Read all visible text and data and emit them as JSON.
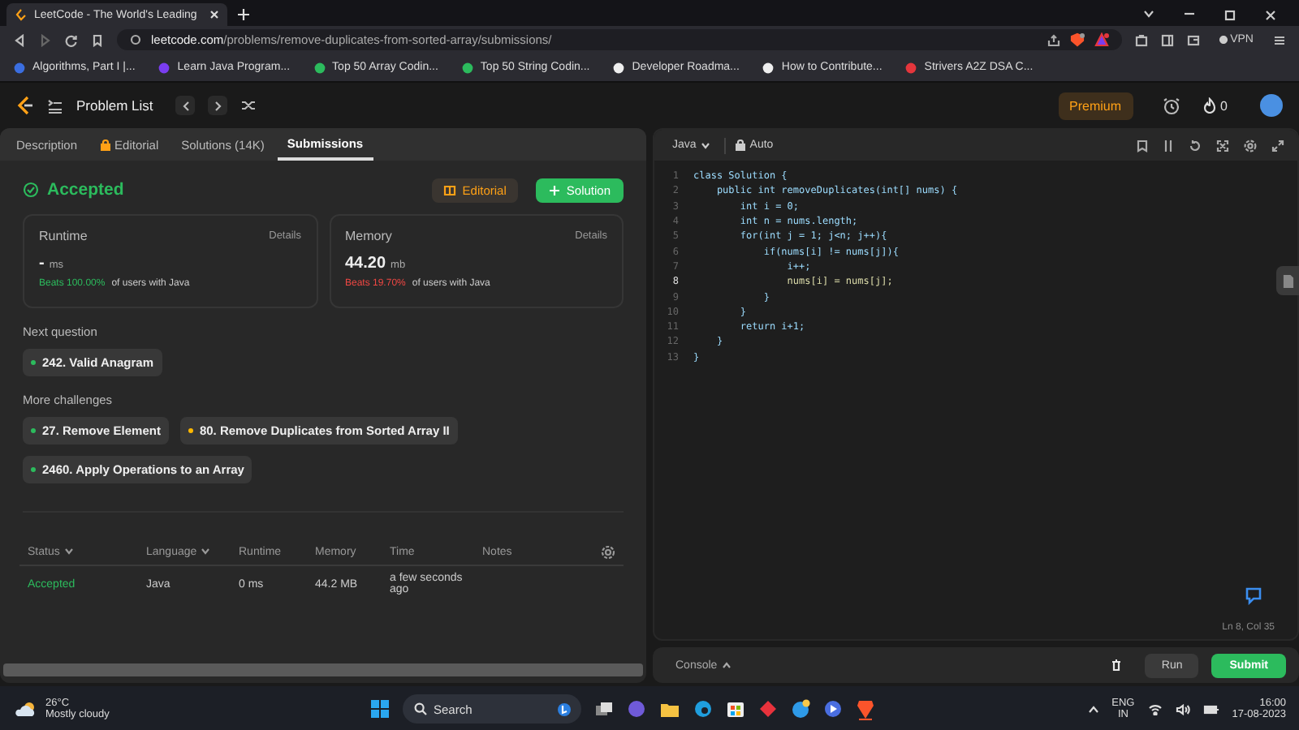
{
  "browser": {
    "tab": {
      "title": "LeetCode - The World's Leading"
    },
    "address": "leetcode.com/problems/remove-duplicates-from-sorted-array/submissions/",
    "vpn": "VPN",
    "bookmarks": [
      {
        "label": "Algorithms, Part I |..."
      },
      {
        "label": "Learn Java Program..."
      },
      {
        "label": "Top 50 Array Codin..."
      },
      {
        "label": "Top 50 String Codin..."
      },
      {
        "label": "Developer Roadma..."
      },
      {
        "label": "How to Contribute..."
      },
      {
        "label": "Strivers A2Z DSA C..."
      }
    ]
  },
  "header": {
    "title": "Problem List",
    "premium": "Premium",
    "streak": "0"
  },
  "left_panel": {
    "tabs": [
      {
        "label": "Description",
        "selected": false,
        "locked": false
      },
      {
        "label": "Editorial",
        "selected": false,
        "locked": true
      },
      {
        "label": "Solutions (14K)",
        "selected": false,
        "locked": false
      },
      {
        "label": "Submissions",
        "selected": true,
        "locked": false
      }
    ],
    "result": {
      "status": "Accepted",
      "editorial_button": "Editorial",
      "solution_button": "Solution"
    },
    "metrics": [
      {
        "title": "Runtime",
        "details": "Details",
        "value": "-",
        "unit": "ms",
        "beats": "Beats 100.00%",
        "color": "#2cbb5d",
        "rest": "of users with Java"
      },
      {
        "title": "Memory",
        "details": "Details",
        "value": "44.20",
        "unit": "mb",
        "beats": "Beats 19.70%",
        "color": "#ef4743",
        "rest": "of users with Java"
      }
    ],
    "next_question": {
      "heading": "Next question",
      "items": [
        {
          "label": "242. Valid Anagram",
          "color": "#2cbb5d"
        }
      ]
    },
    "more_challenges": {
      "heading": "More challenges",
      "items": [
        {
          "label": "27. Remove Element",
          "color": "#2cbb5d"
        },
        {
          "label": "80. Remove Duplicates from Sorted Array II",
          "color": "#ffb800"
        },
        {
          "label": "2460. Apply Operations to an Array",
          "color": "#2cbb5d"
        }
      ]
    },
    "submissions": {
      "columns": [
        {
          "label": "Status",
          "sortable": true
        },
        {
          "label": "Language",
          "sortable": true
        },
        {
          "label": "Runtime",
          "sortable": false
        },
        {
          "label": "Memory",
          "sortable": false
        },
        {
          "label": "Time",
          "sortable": false
        },
        {
          "label": "Notes",
          "sortable": false
        }
      ],
      "rows": [
        {
          "status": "Accepted",
          "language": "Java",
          "runtime": "0 ms",
          "memory": "44.2 MB",
          "time": "a few seconds ago"
        }
      ]
    }
  },
  "editor": {
    "language": "Java",
    "mode": "Auto",
    "cursor": "Ln 8, Col 35",
    "lines": [
      {
        "number": "1",
        "code": "class Solution {",
        "current": false
      },
      {
        "number": "2",
        "code": "    public int removeDuplicates(int[] nums) {",
        "current": false
      },
      {
        "number": "3",
        "code": "        int i = 0;",
        "current": false
      },
      {
        "number": "4",
        "code": "        int n = nums.length;",
        "current": false
      },
      {
        "number": "5",
        "code": "        for(int j = 1; j<n; j++){",
        "current": false
      },
      {
        "number": "6",
        "code": "            if(nums[i] != nums[j]){",
        "current": false
      },
      {
        "number": "7",
        "code": "                i++;",
        "current": false
      },
      {
        "number": "8",
        "code": "                nums[i] = nums[j];",
        "current": true
      },
      {
        "number": "9",
        "code": "            }",
        "current": false
      },
      {
        "number": "10",
        "code": "        }",
        "current": false
      },
      {
        "number": "11",
        "code": "        return i+1;",
        "current": false
      },
      {
        "number": "12",
        "code": "    }",
        "current": false
      },
      {
        "number": "13",
        "code": "}",
        "current": false
      }
    ]
  },
  "console": {
    "label": "Console",
    "run": "Run",
    "submit": "Submit"
  },
  "taskbar": {
    "temperature": "26°C",
    "weather": "Mostly cloudy",
    "search": {
      "placeholder": "Search"
    },
    "language": "ENG",
    "region": "IN",
    "time": "16:00",
    "date": "17-08-2023"
  }
}
